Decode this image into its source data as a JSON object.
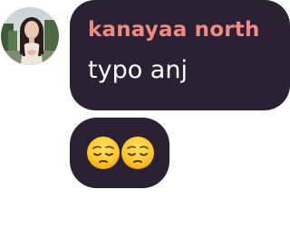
{
  "messages": [
    {
      "sender": "kanayaa north",
      "text": "typo anj",
      "sender_color": "#f08a84"
    },
    {
      "emojis": [
        "pensive-face",
        "pensive-face"
      ]
    }
  ],
  "colors": {
    "bubble": "#2a2233",
    "text": "#ffffff",
    "background": "#ffffff"
  },
  "icons": {
    "avatar": "user-avatar-photo",
    "emoji": "pensive-face-emoji"
  }
}
